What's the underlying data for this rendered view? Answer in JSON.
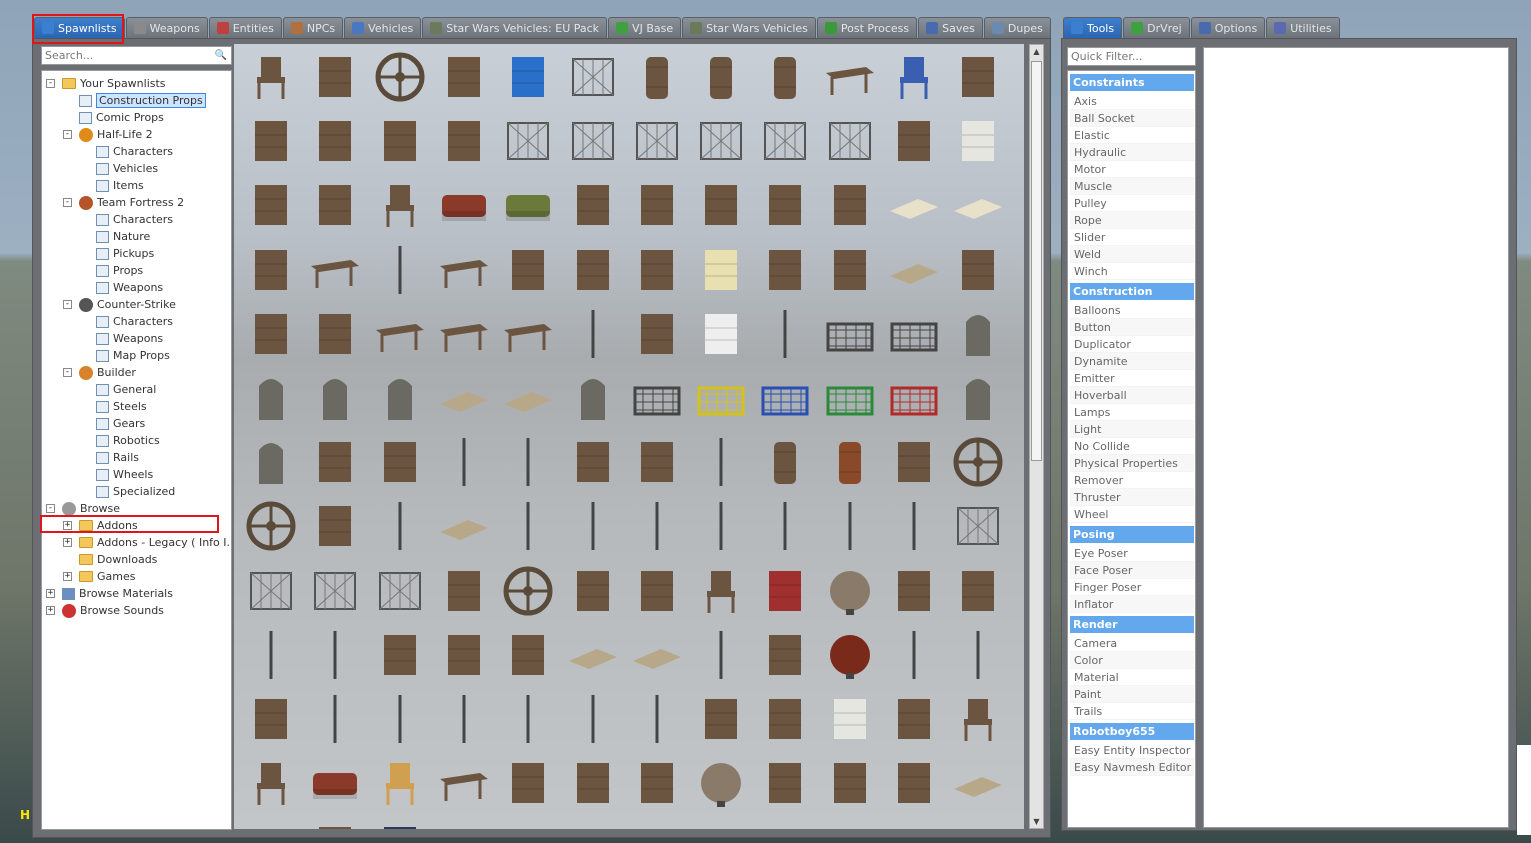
{
  "left_tabs": [
    {
      "label": "Spawnlists",
      "icon": "grid-icon",
      "color": "#3b7fd0"
    },
    {
      "label": "Weapons",
      "icon": "gun-icon",
      "color": "#8a8a8a"
    },
    {
      "label": "Entities",
      "icon": "entity-icon",
      "color": "#c04040"
    },
    {
      "label": "NPCs",
      "icon": "npc-icon",
      "color": "#b07040"
    },
    {
      "label": "Vehicles",
      "icon": "car-icon",
      "color": "#4a78c0"
    },
    {
      "label": "Star Wars Vehicles: EU Pack",
      "icon": "grid-icon",
      "color": "#6a7a5a"
    },
    {
      "label": "VJ Base",
      "icon": "vj-icon",
      "color": "#3fa03f"
    },
    {
      "label": "Star Wars Vehicles",
      "icon": "grid-icon",
      "color": "#6a7a5a"
    },
    {
      "label": "Post Process",
      "icon": "image-icon",
      "color": "#3a9a3a"
    },
    {
      "label": "Saves",
      "icon": "disk-icon",
      "color": "#4a6ab0"
    },
    {
      "label": "Dupes",
      "icon": "dupe-icon",
      "color": "#6a8ab0"
    }
  ],
  "right_tabs": [
    {
      "label": "Tools",
      "icon": "wrench-icon",
      "color": "#3b7fd0"
    },
    {
      "label": "DrVrej",
      "icon": "vj-icon",
      "color": "#3fa03f"
    },
    {
      "label": "Options",
      "icon": "wrench-icon",
      "color": "#4a6ab0"
    },
    {
      "label": "Utilities",
      "icon": "doc-icon",
      "color": "#5a6ab0"
    }
  ],
  "search_placeholder": "Search...",
  "filter_placeholder": "Quick Filter...",
  "tree": [
    {
      "label": "Your Spawnlists",
      "level": 0,
      "icon": "folder",
      "toggle": "-"
    },
    {
      "label": "Construction Props",
      "level": 1,
      "icon": "file",
      "selected": true
    },
    {
      "label": "Comic Props",
      "level": 1,
      "icon": "file"
    },
    {
      "label": "Half-Life 2",
      "level": 1,
      "icon": "hl2",
      "toggle": "-"
    },
    {
      "label": "Characters",
      "level": 2,
      "icon": "file"
    },
    {
      "label": "Vehicles",
      "level": 2,
      "icon": "file"
    },
    {
      "label": "Items",
      "level": 2,
      "icon": "file"
    },
    {
      "label": "Team Fortress 2",
      "level": 1,
      "icon": "tf2",
      "toggle": "-"
    },
    {
      "label": "Characters",
      "level": 2,
      "icon": "file"
    },
    {
      "label": "Nature",
      "level": 2,
      "icon": "file"
    },
    {
      "label": "Pickups",
      "level": 2,
      "icon": "file"
    },
    {
      "label": "Props",
      "level": 2,
      "icon": "file"
    },
    {
      "label": "Weapons",
      "level": 2,
      "icon": "file"
    },
    {
      "label": "Counter-Strike",
      "level": 1,
      "icon": "cs",
      "toggle": "-"
    },
    {
      "label": "Characters",
      "level": 2,
      "icon": "file"
    },
    {
      "label": "Weapons",
      "level": 2,
      "icon": "file"
    },
    {
      "label": "Map Props",
      "level": 2,
      "icon": "file"
    },
    {
      "label": "Builder",
      "level": 1,
      "icon": "builder",
      "toggle": "-"
    },
    {
      "label": "General",
      "level": 2,
      "icon": "file"
    },
    {
      "label": "Steels",
      "level": 2,
      "icon": "file"
    },
    {
      "label": "Gears",
      "level": 2,
      "icon": "file"
    },
    {
      "label": "Robotics",
      "level": 2,
      "icon": "file"
    },
    {
      "label": "Rails",
      "level": 2,
      "icon": "file"
    },
    {
      "label": "Wheels",
      "level": 2,
      "icon": "file"
    },
    {
      "label": "Specialized",
      "level": 2,
      "icon": "file"
    },
    {
      "label": "Browse",
      "level": 0,
      "icon": "gear",
      "toggle": "-"
    },
    {
      "label": "Addons",
      "level": 1,
      "icon": "folder",
      "toggle": "+"
    },
    {
      "label": "Addons - Legacy ( Info I...",
      "level": 1,
      "icon": "folder",
      "toggle": "+"
    },
    {
      "label": "Downloads",
      "level": 1,
      "icon": "folder"
    },
    {
      "label": "Games",
      "level": 1,
      "icon": "folder",
      "toggle": "+"
    },
    {
      "label": "Browse Materials",
      "level": 0,
      "icon": "material",
      "toggle": "+"
    },
    {
      "label": "Browse Sounds",
      "level": 0,
      "icon": "sound",
      "toggle": "+"
    }
  ],
  "tool_categories": [
    {
      "name": "Constraints",
      "items": [
        "Axis",
        "Ball Socket",
        "Elastic",
        "Hydraulic",
        "Motor",
        "Muscle",
        "Pulley",
        "Rope",
        "Slider",
        "Weld",
        "Winch"
      ]
    },
    {
      "name": "Construction",
      "items": [
        "Balloons",
        "Button",
        "Duplicator",
        "Dynamite",
        "Emitter",
        "Hoverball",
        "Lamps",
        "Light",
        "No Collide",
        "Physical Properties",
        "Remover",
        "Thruster",
        "Wheel"
      ]
    },
    {
      "name": "Posing",
      "items": [
        "Eye Poser",
        "Face Poser",
        "Finger Poser",
        "Inflator"
      ]
    },
    {
      "name": "Render",
      "items": [
        "Camera",
        "Color",
        "Material",
        "Paint",
        "Trails"
      ]
    },
    {
      "name": "Robotboy655",
      "items": [
        "Easy Entity Inspector",
        "Easy Navmesh Editor"
      ]
    }
  ],
  "props": [
    "stool",
    "cable-spools",
    "wheel",
    "sign-plate",
    "blue-barrel",
    "gate",
    "gas-cylinder",
    "gas-cylinder-red",
    "water-tank",
    "bench",
    "chair-blue",
    "lamp-post",
    "concrete-barrier",
    "display-case",
    "door",
    "door-frame",
    "fence",
    "fence",
    "fence",
    "fence",
    "fence",
    "fence",
    "fountain",
    "bathtub",
    "bed-frame",
    "water-heater",
    "chair",
    "sofa",
    "sofa-green",
    "cabinet",
    "dresser",
    "drawer",
    "drawer",
    "shelf",
    "mattress",
    "mattress",
    "wardrobe",
    "table",
    "pole",
    "desk",
    "cabinet-tall",
    "cupboard",
    "stove",
    "fridge",
    "radiator",
    "locker",
    "plank",
    "rack",
    "sink",
    "oven",
    "round-table",
    "table",
    "table",
    "pole",
    "toilet",
    "washer",
    "pole",
    "cage-door",
    "cage-door",
    "gravestone",
    "gravestone",
    "gravestone",
    "gravestone",
    "slab",
    "slab",
    "cross",
    "cage",
    "cage-yellow",
    "cage-blue",
    "cage-green",
    "cage-red",
    "statue",
    "statue",
    "lampshade",
    "lockers",
    "pole",
    "pole",
    "pipe",
    "pipe",
    "pole",
    "barrel",
    "barrel-rust",
    "hook",
    "gear",
    "gear",
    "shelf",
    "pole",
    "plank",
    "pole",
    "pole",
    "pole",
    "pole",
    "pole",
    "pole",
    "pole",
    "truss",
    "truss",
    "truss",
    "truss",
    "arc",
    "ring",
    "fan",
    "fan",
    "office-chair",
    "chest",
    "globe",
    "frame",
    "stairs",
    "pole",
    "pole",
    "panel",
    "helmet",
    "vent",
    "plank",
    "plank",
    "pole",
    "axe",
    "bomb",
    "pole",
    "pole",
    "bone",
    "pole",
    "pole",
    "pole",
    "pole",
    "pole",
    "pole",
    "locker",
    "tree",
    "bathtub",
    "door-frame",
    "chair",
    "chair",
    "sofa",
    "armchair",
    "desk",
    "lamp",
    "shelf",
    "vanity",
    "kettle",
    "pan",
    "radiator",
    "bookcase",
    "plank",
    "mattress",
    "sink",
    "vending"
  ],
  "hud_text": "H",
  "colors": {
    "accent": "#3b7fd0",
    "category": "#63a7ec",
    "highlight": "#e0141b"
  }
}
